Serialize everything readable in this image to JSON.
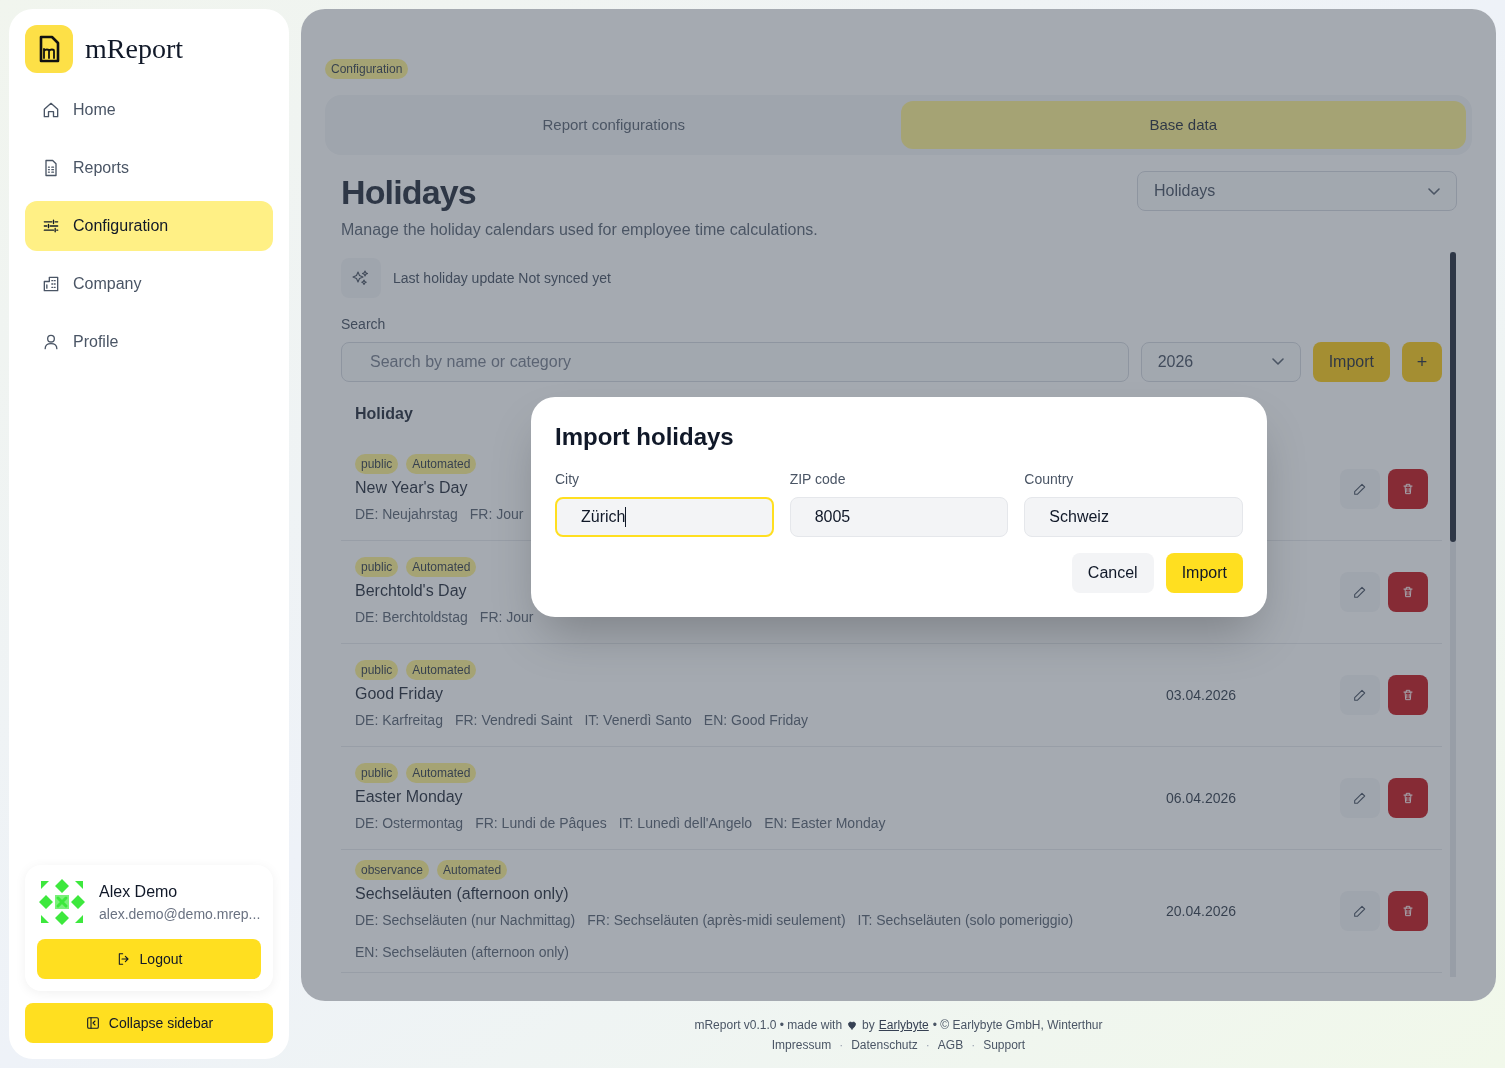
{
  "sidebar": {
    "brand": "mReport",
    "nav": [
      {
        "label": "Home",
        "selected": false
      },
      {
        "label": "Reports",
        "selected": false
      },
      {
        "label": "Configuration",
        "selected": true
      },
      {
        "label": "Company",
        "selected": false
      },
      {
        "label": "Profile",
        "selected": false
      }
    ],
    "user": {
      "name": "Alex Demo",
      "email": "alex.demo@demo.mrep..."
    },
    "logout": "Logout",
    "collapse": "Collapse sidebar"
  },
  "main": {
    "breadcrumb": "Configuration",
    "tabs": [
      {
        "label": "Report configurations",
        "selected": false
      },
      {
        "label": "Base data",
        "selected": true
      }
    ],
    "title": "Holidays",
    "subtitle": "Manage the holiday calendars used for employee time calculations.",
    "section_select": "Holidays",
    "sync": "Last holiday update Not synced yet",
    "search": {
      "label": "Search",
      "placeholder": "Search by name or category"
    },
    "year": "2026",
    "import_button": "Import",
    "add_button": "+",
    "list": {
      "header": "Holiday",
      "rows": [
        {
          "tags": [
            "public",
            "Automated"
          ],
          "name": "New Year's Day",
          "translations": [
            "DE: Neujahrstag",
            "FR: Jour"
          ]
        },
        {
          "tags": [
            "public",
            "Automated"
          ],
          "name": "Berchtold's Day",
          "translations": [
            "DE: Berchtoldstag",
            "FR: Jour"
          ]
        },
        {
          "tags": [
            "public",
            "Automated"
          ],
          "name": "Good Friday",
          "translations": [
            "DE: Karfreitag",
            "FR: Vendredi Saint",
            "IT: Venerdì Santo",
            "EN: Good Friday"
          ],
          "date": "03.04.2026"
        },
        {
          "tags": [
            "public",
            "Automated"
          ],
          "name": "Easter Monday",
          "translations": [
            "DE: Ostermontag",
            "FR: Lundi de Pâques",
            "IT: Lunedì dell'Angelo",
            "EN: Easter Monday"
          ],
          "date": "06.04.2026"
        },
        {
          "tags": [
            "observance",
            "Automated"
          ],
          "name": "Sechseläuten (afternoon only)",
          "translations": [
            "DE: Sechseläuten (nur Nachmittag)",
            "FR: Sechseläuten (après-midi seulement)",
            "IT: Sechseläuten (solo pomeriggio)",
            "EN: Sechseläuten (afternoon only)"
          ],
          "date": "20.04.2026"
        }
      ]
    }
  },
  "modal": {
    "title": "Import holidays",
    "fields": [
      {
        "label": "City",
        "value": "Zürich",
        "focused": true
      },
      {
        "label": "ZIP code",
        "value": "8005",
        "focused": false
      },
      {
        "label": "Country",
        "value": "Schweiz",
        "focused": false
      }
    ],
    "cancel": "Cancel",
    "confirm": "Import"
  },
  "footer": {
    "version": "mReport v0.1.0 • made with",
    "by": "by",
    "link": "Earlybyte",
    "copyright": "• © Earlybyte GmbH, Winterthur",
    "links": [
      "Impressum",
      "Datenschutz",
      "AGB",
      "Support"
    ],
    "separator": "·"
  }
}
